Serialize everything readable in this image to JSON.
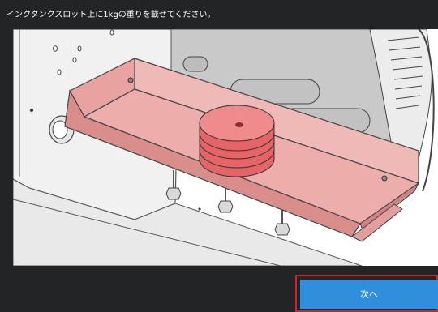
{
  "instruction": "インクタンクスロット上に1kgの重りを載せてください。",
  "illustration": {
    "subject": "printer-ink-tank-slot-with-weight"
  },
  "buttons": {
    "next_label": "次へ"
  },
  "colors": {
    "background": "#232426",
    "highlight_tray": "#e8a3a1",
    "weight": "#e96b6e",
    "button": "#2f8fdc",
    "focus_outline": "#d5202c"
  }
}
